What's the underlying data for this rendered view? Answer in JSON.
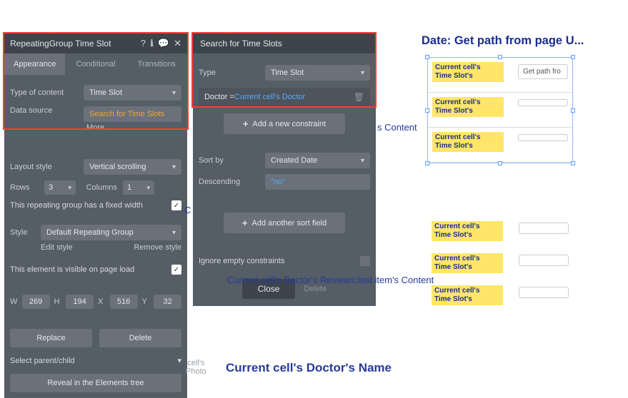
{
  "panel1": {
    "title": "RepeatingGroup Time Slot",
    "tabs": {
      "appearance": "Appearance",
      "conditional": "Conditional",
      "transitions": "Transitions"
    },
    "type_of_content_label": "Type of content",
    "type_of_content_value": "Time Slot",
    "data_source_label": "Data source",
    "data_source_value": "Search for Time Slots",
    "more": "More...",
    "layout_style_label": "Layout style",
    "layout_style_value": "Vertical scrolling",
    "rows_label": "Rows",
    "rows_value": "3",
    "columns_label": "Columns",
    "columns_value": "1",
    "fixed_width_label": "This repeating group has a fixed width",
    "style_label": "Style",
    "style_value": "Default Repeating Group",
    "edit_style": "Edit style",
    "remove_style": "Remove style",
    "visible_label": "This element is visible on page load",
    "w_label": "W",
    "w_value": "269",
    "h_label": "H",
    "h_value": "194",
    "x_label": "X",
    "x_value": "516",
    "y_label": "Y",
    "y_value": "32",
    "replace_btn": "Replace",
    "delete_btn": "Delete",
    "select_parent_label": "Select parent/child",
    "reveal_btn": "Reveal in the Elements tree"
  },
  "panel2": {
    "title": "Search for Time Slots",
    "type_label": "Type",
    "type_value": "Time Slot",
    "constraint_field": "Doctor = ",
    "constraint_value": "Current cell's Doctor",
    "add_constraint": "Add a new constraint",
    "sort_by_label": "Sort by",
    "sort_by_value": "Created Date",
    "descending_label": "Descending",
    "descending_value": "\"no\"",
    "add_sort": "Add another sort field",
    "ignore_empty": "Ignore empty constraints",
    "close": "Close",
    "delete": "Delete"
  },
  "canvas": {
    "date_title": "Date: Get path from page U...",
    "badge_line1": "Current cell's",
    "badge_line2": "Time Slot's",
    "get_path": "Get path fro",
    "reviews_partial_content": "s Content",
    "reviews_full": "Current cell's Doctor's Reviews:last item's Content",
    "reviews_leading_c": "C",
    "doctor_name": "Current cell's Doctor's Name",
    "photo_l1": "cell's",
    "photo_l2": "Photo"
  }
}
